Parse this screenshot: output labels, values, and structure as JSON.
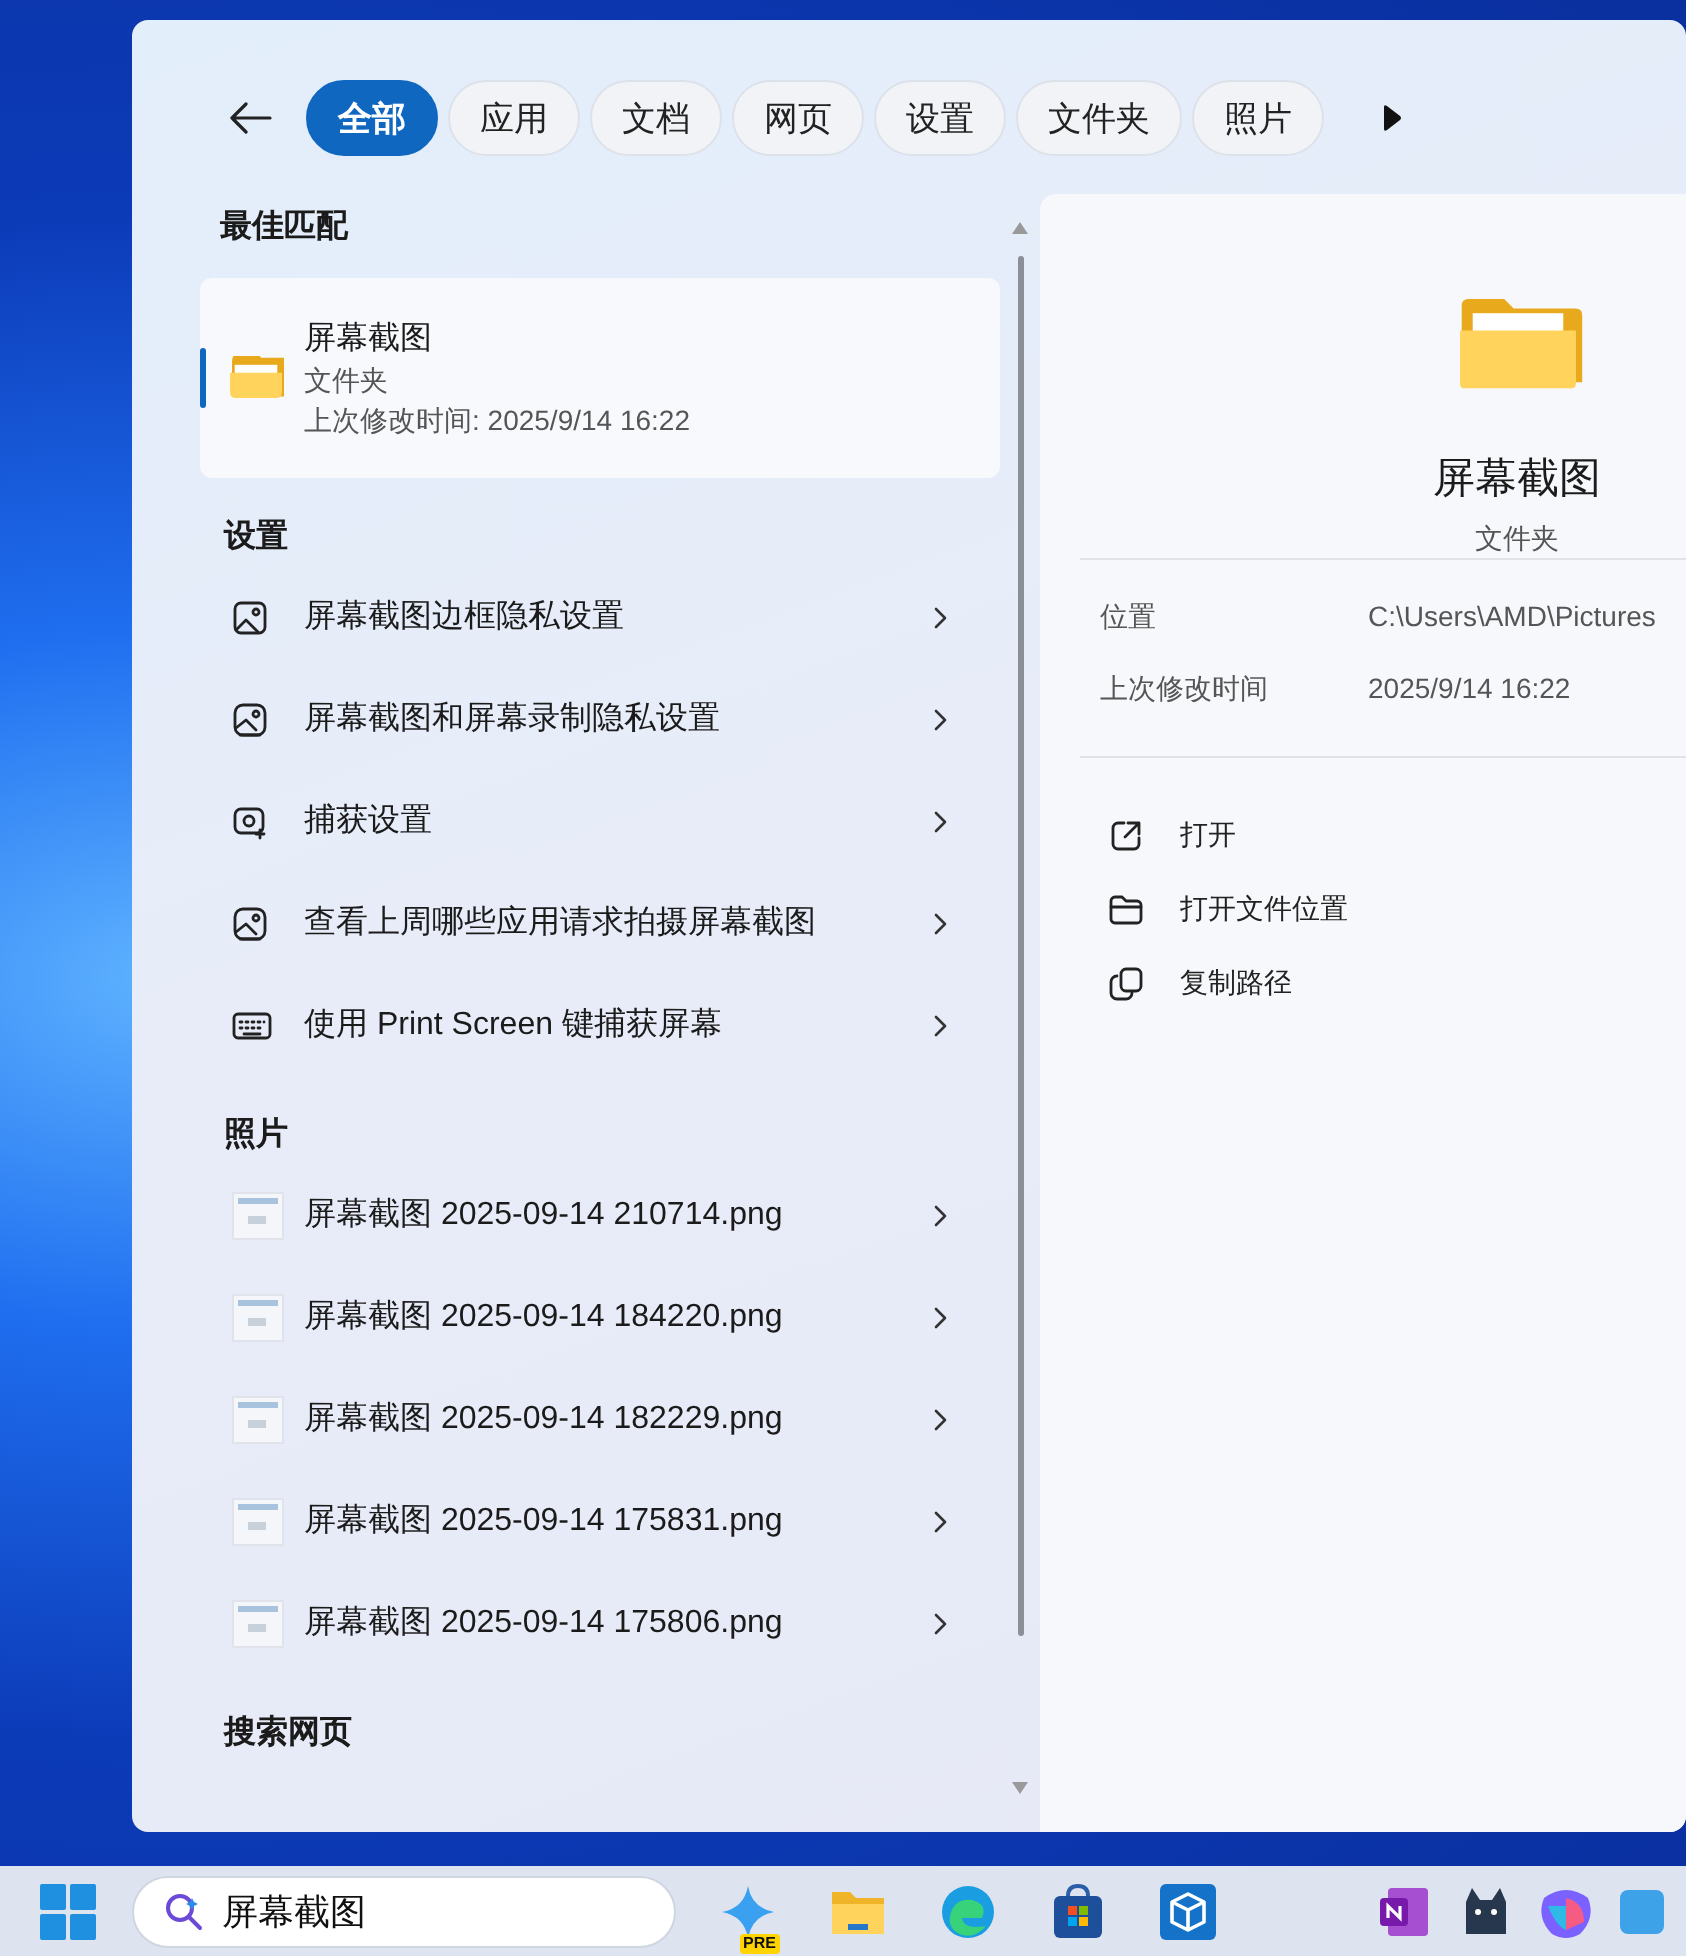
{
  "search_panel": {
    "tabs": [
      {
        "label": "全部",
        "selected": true
      },
      {
        "label": "应用",
        "selected": false
      },
      {
        "label": "文档",
        "selected": false
      },
      {
        "label": "网页",
        "selected": false
      },
      {
        "label": "设置",
        "selected": false
      },
      {
        "label": "文件夹",
        "selected": false
      },
      {
        "label": "照片",
        "selected": false
      }
    ],
    "best_match": {
      "heading": "最佳匹配",
      "title": "屏幕截图",
      "type": "文件夹",
      "modified": "上次修改时间: 2025/9/14 16:22",
      "selected": true
    },
    "sections": [
      {
        "heading": "设置",
        "items": [
          {
            "kind": "image",
            "label": "屏幕截图边框隐私设置"
          },
          {
            "kind": "privacy",
            "label": "屏幕截图和屏幕录制隐私设置"
          },
          {
            "kind": "capture",
            "label": "捕获设置"
          },
          {
            "kind": "privacy",
            "label": "查看上周哪些应用请求拍摄屏幕截图"
          },
          {
            "kind": "keyboard",
            "label": "使用 Print Screen 键捕获屏幕"
          }
        ]
      },
      {
        "heading": "照片",
        "items": [
          {
            "kind": "thumbnail",
            "label": "屏幕截图 2025-09-14 210714.png"
          },
          {
            "kind": "thumbnail",
            "label": "屏幕截图 2025-09-14 184220.png"
          },
          {
            "kind": "thumbnail",
            "label": "屏幕截图 2025-09-14 182229.png"
          },
          {
            "kind": "thumbnail",
            "label": "屏幕截图 2025-09-14 175831.png"
          },
          {
            "kind": "thumbnail",
            "label": "屏幕截图 2025-09-14 175806.png"
          }
        ]
      },
      {
        "heading": "搜索网页"
      }
    ],
    "preview": {
      "title": "屏幕截图",
      "type": "文件夹",
      "properties": [
        {
          "label": "位置",
          "value": "C:\\Users\\AMD\\Pictures"
        },
        {
          "label": "上次修改时间",
          "value": "2025/9/14 16:22"
        }
      ],
      "actions": [
        {
          "kind": "open",
          "label": "打开"
        },
        {
          "kind": "folder",
          "label": "打开文件位置"
        },
        {
          "kind": "copy",
          "label": "复制路径"
        }
      ]
    }
  },
  "taskbar": {
    "search": {
      "value": "屏幕截图"
    },
    "apps": [
      {
        "kind": "copilot",
        "badge": "PRE"
      },
      {
        "kind": "files"
      },
      {
        "kind": "browser"
      },
      {
        "kind": "store"
      },
      {
        "kind": "cube"
      }
    ],
    "tray_apps": [
      {
        "kind": "notebook"
      },
      {
        "kind": "cat"
      },
      {
        "kind": "m365"
      },
      {
        "kind": "edge_cut"
      }
    ]
  }
}
